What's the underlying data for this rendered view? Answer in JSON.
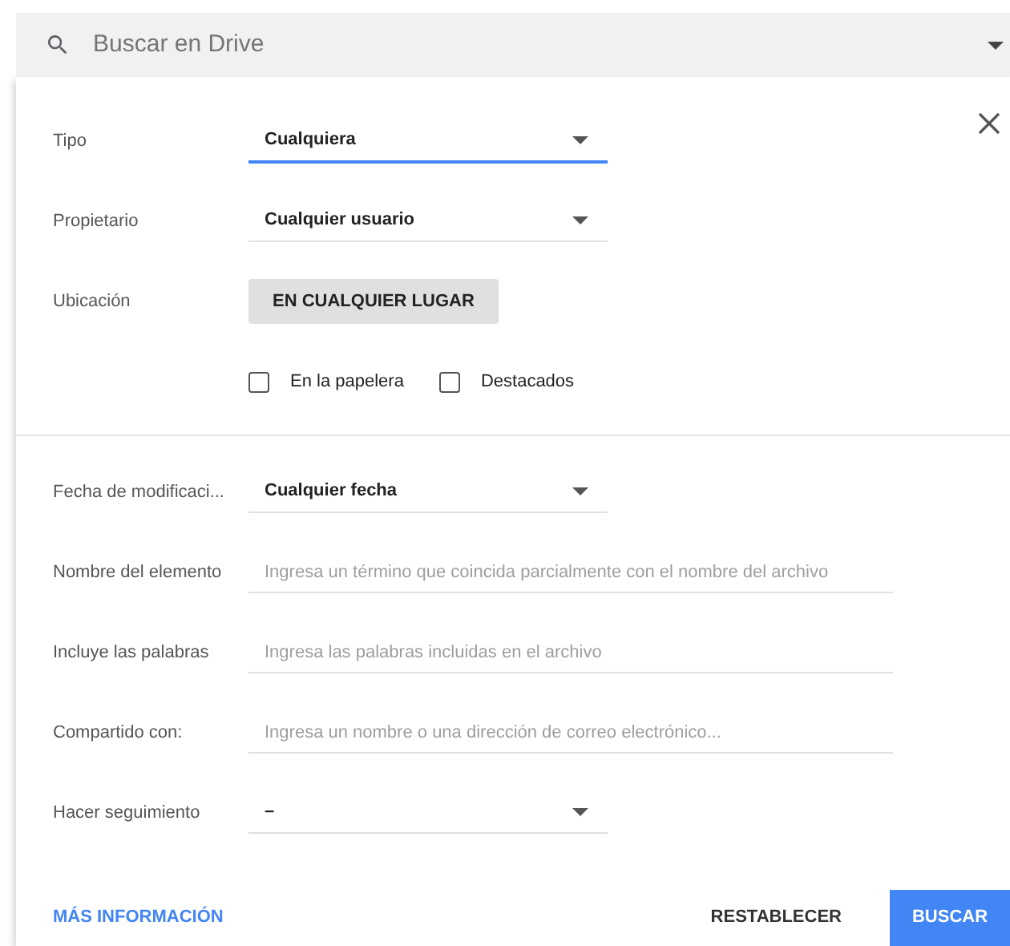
{
  "search": {
    "placeholder": "Buscar en Drive"
  },
  "sections": [
    {
      "rows": [
        {
          "kind": "dropdown",
          "label": "Tipo",
          "value": "Cualquiera",
          "focused": true
        },
        {
          "kind": "dropdown",
          "label": "Propietario",
          "value": "Cualquier usuario",
          "focused": false
        },
        {
          "kind": "button",
          "label": "Ubicación",
          "value": "EN CUALQUIER LUGAR"
        },
        {
          "kind": "checkboxes",
          "options": [
            {
              "label": "En la papelera",
              "checked": false
            },
            {
              "label": "Destacados",
              "checked": false
            }
          ]
        }
      ]
    },
    {
      "rows": [
        {
          "kind": "dropdown",
          "label": "Fecha de modificaci...",
          "value": "Cualquier fecha",
          "focused": false
        },
        {
          "kind": "textfield",
          "label": "Nombre del elemento",
          "placeholder": "Ingresa un término que coincida parcialmente con el nombre del archivo"
        },
        {
          "kind": "textfield",
          "label": "Incluye las palabras",
          "placeholder": "Ingresa las palabras incluidas en el archivo"
        },
        {
          "kind": "textfield",
          "label": "Compartido con:",
          "placeholder": "Ingresa un nombre o una dirección de correo electrónico..."
        },
        {
          "kind": "dropdown",
          "label": "Hacer seguimiento",
          "value": "–",
          "focused": false
        }
      ]
    }
  ],
  "footer": {
    "link": "MÁS INFORMACIÓN",
    "reset": "RESTABLECER",
    "submit": "BUSCAR"
  }
}
